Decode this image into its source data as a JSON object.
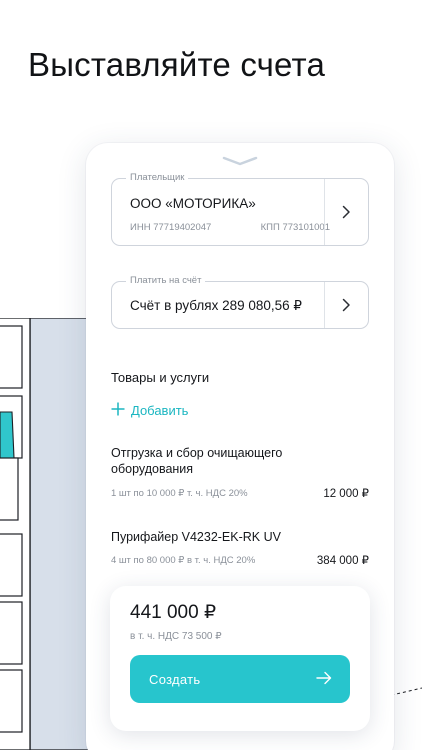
{
  "headline": "Выставляйте счета",
  "payer": {
    "label": "Плательщик",
    "name": "ООО «МОТОРИКА»",
    "inn": "ИНН 77719402047",
    "kpp": "КПП 773101001"
  },
  "account": {
    "label": "Платить на счёт",
    "value": "Счёт в рублях 289 080,56 ₽"
  },
  "goods": {
    "title": "Товары и услуги",
    "add_label": "Добавить",
    "items": [
      {
        "name": "Отгрузка и сбор очищающего оборудования",
        "meta": "1 шт по 10 000 ₽ т. ч. НДС 20%",
        "price": "12 000 ₽"
      },
      {
        "name": "Пурифайер V4232-EK-RK UV",
        "meta": "4 шт по 80 000 ₽ в т. ч. НДС 20%",
        "price": "384 000 ₽"
      }
    ]
  },
  "summary": {
    "total": "441 000 ₽",
    "vat": "в т. ч. НДС 73 500 ₽",
    "create_label": "Создать"
  },
  "colors": {
    "accent": "#27c5cd",
    "accent_text": "#1bb6c1",
    "illustration_fill": "#d7dfea",
    "illustration_accent": "#30c6cc"
  }
}
